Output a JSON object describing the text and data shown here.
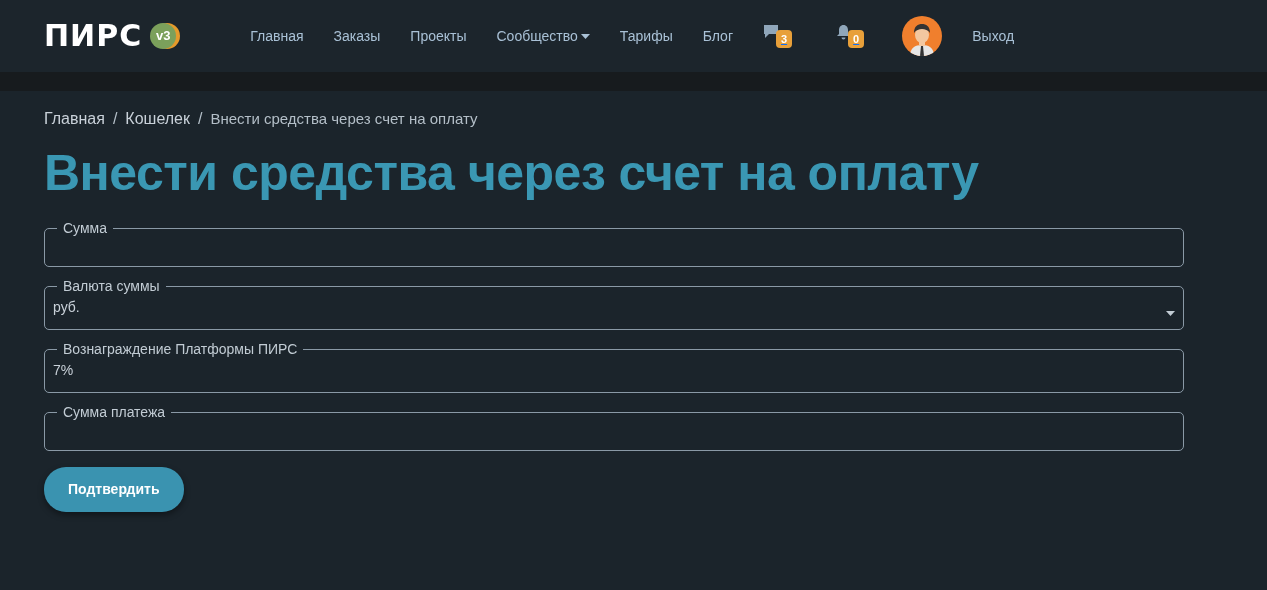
{
  "navbar": {
    "logo": "ПИРС",
    "version": "v3",
    "links": [
      {
        "label": "Главная",
        "dropdown": false
      },
      {
        "label": "Заказы",
        "dropdown": false
      },
      {
        "label": "Проекты",
        "dropdown": false
      },
      {
        "label": "Сообщество",
        "dropdown": true
      },
      {
        "label": "Тарифы",
        "dropdown": false
      },
      {
        "label": "Блог",
        "dropdown": false
      }
    ],
    "messages_count": "3",
    "notifications_count": "0",
    "logout": "Выход"
  },
  "breadcrumb_separator": "/",
  "breadcrumb": [
    {
      "label": "Главная",
      "current": false
    },
    {
      "label": "Кошелек",
      "current": false
    },
    {
      "label": "Внести средства через счет на оплату",
      "current": true
    }
  ],
  "title": "Внести средства через счет на оплату",
  "fields": [
    {
      "kind": "input",
      "label": "Сумма"
    },
    {
      "kind": "select",
      "label": "Валюта суммы",
      "value": "руб."
    },
    {
      "kind": "input",
      "label": "Вознаграждение Платформы ПИРС",
      "value": "7%"
    },
    {
      "kind": "input",
      "label": "Сумма платежа"
    }
  ],
  "submit": "Подтвердить"
}
